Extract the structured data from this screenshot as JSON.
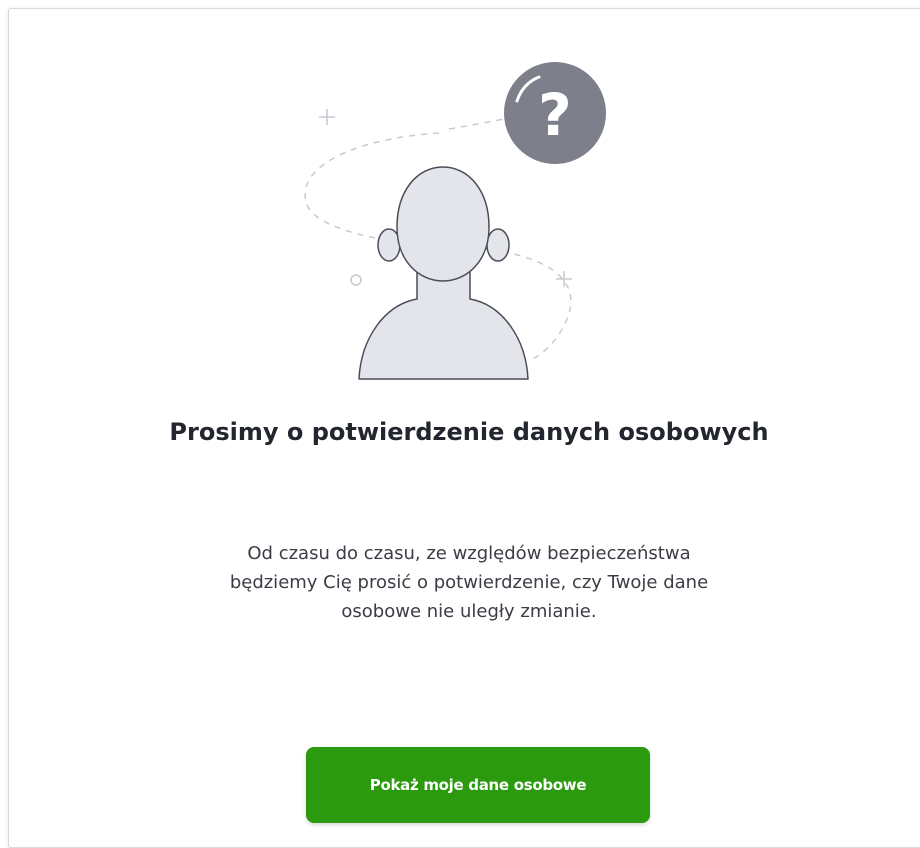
{
  "illustration": {
    "icon": "person-question-icon",
    "question_mark": "?",
    "badge_color": "#7d7f8b",
    "figure_color": "#e4e5ea",
    "line_color": "#c8c9d0"
  },
  "heading": {
    "title": "Prosimy o potwierdzenie danych osobowych"
  },
  "body": {
    "description": "Od czasu do czasu, ze względów bezpieczeństwa będziemy Cię prosić o potwierdzenie, czy Twoje dane osobowe nie uległy zmianie."
  },
  "actions": {
    "primary_label": "Pokaż moje dane osobowe",
    "primary_color": "#2b9a0f"
  }
}
